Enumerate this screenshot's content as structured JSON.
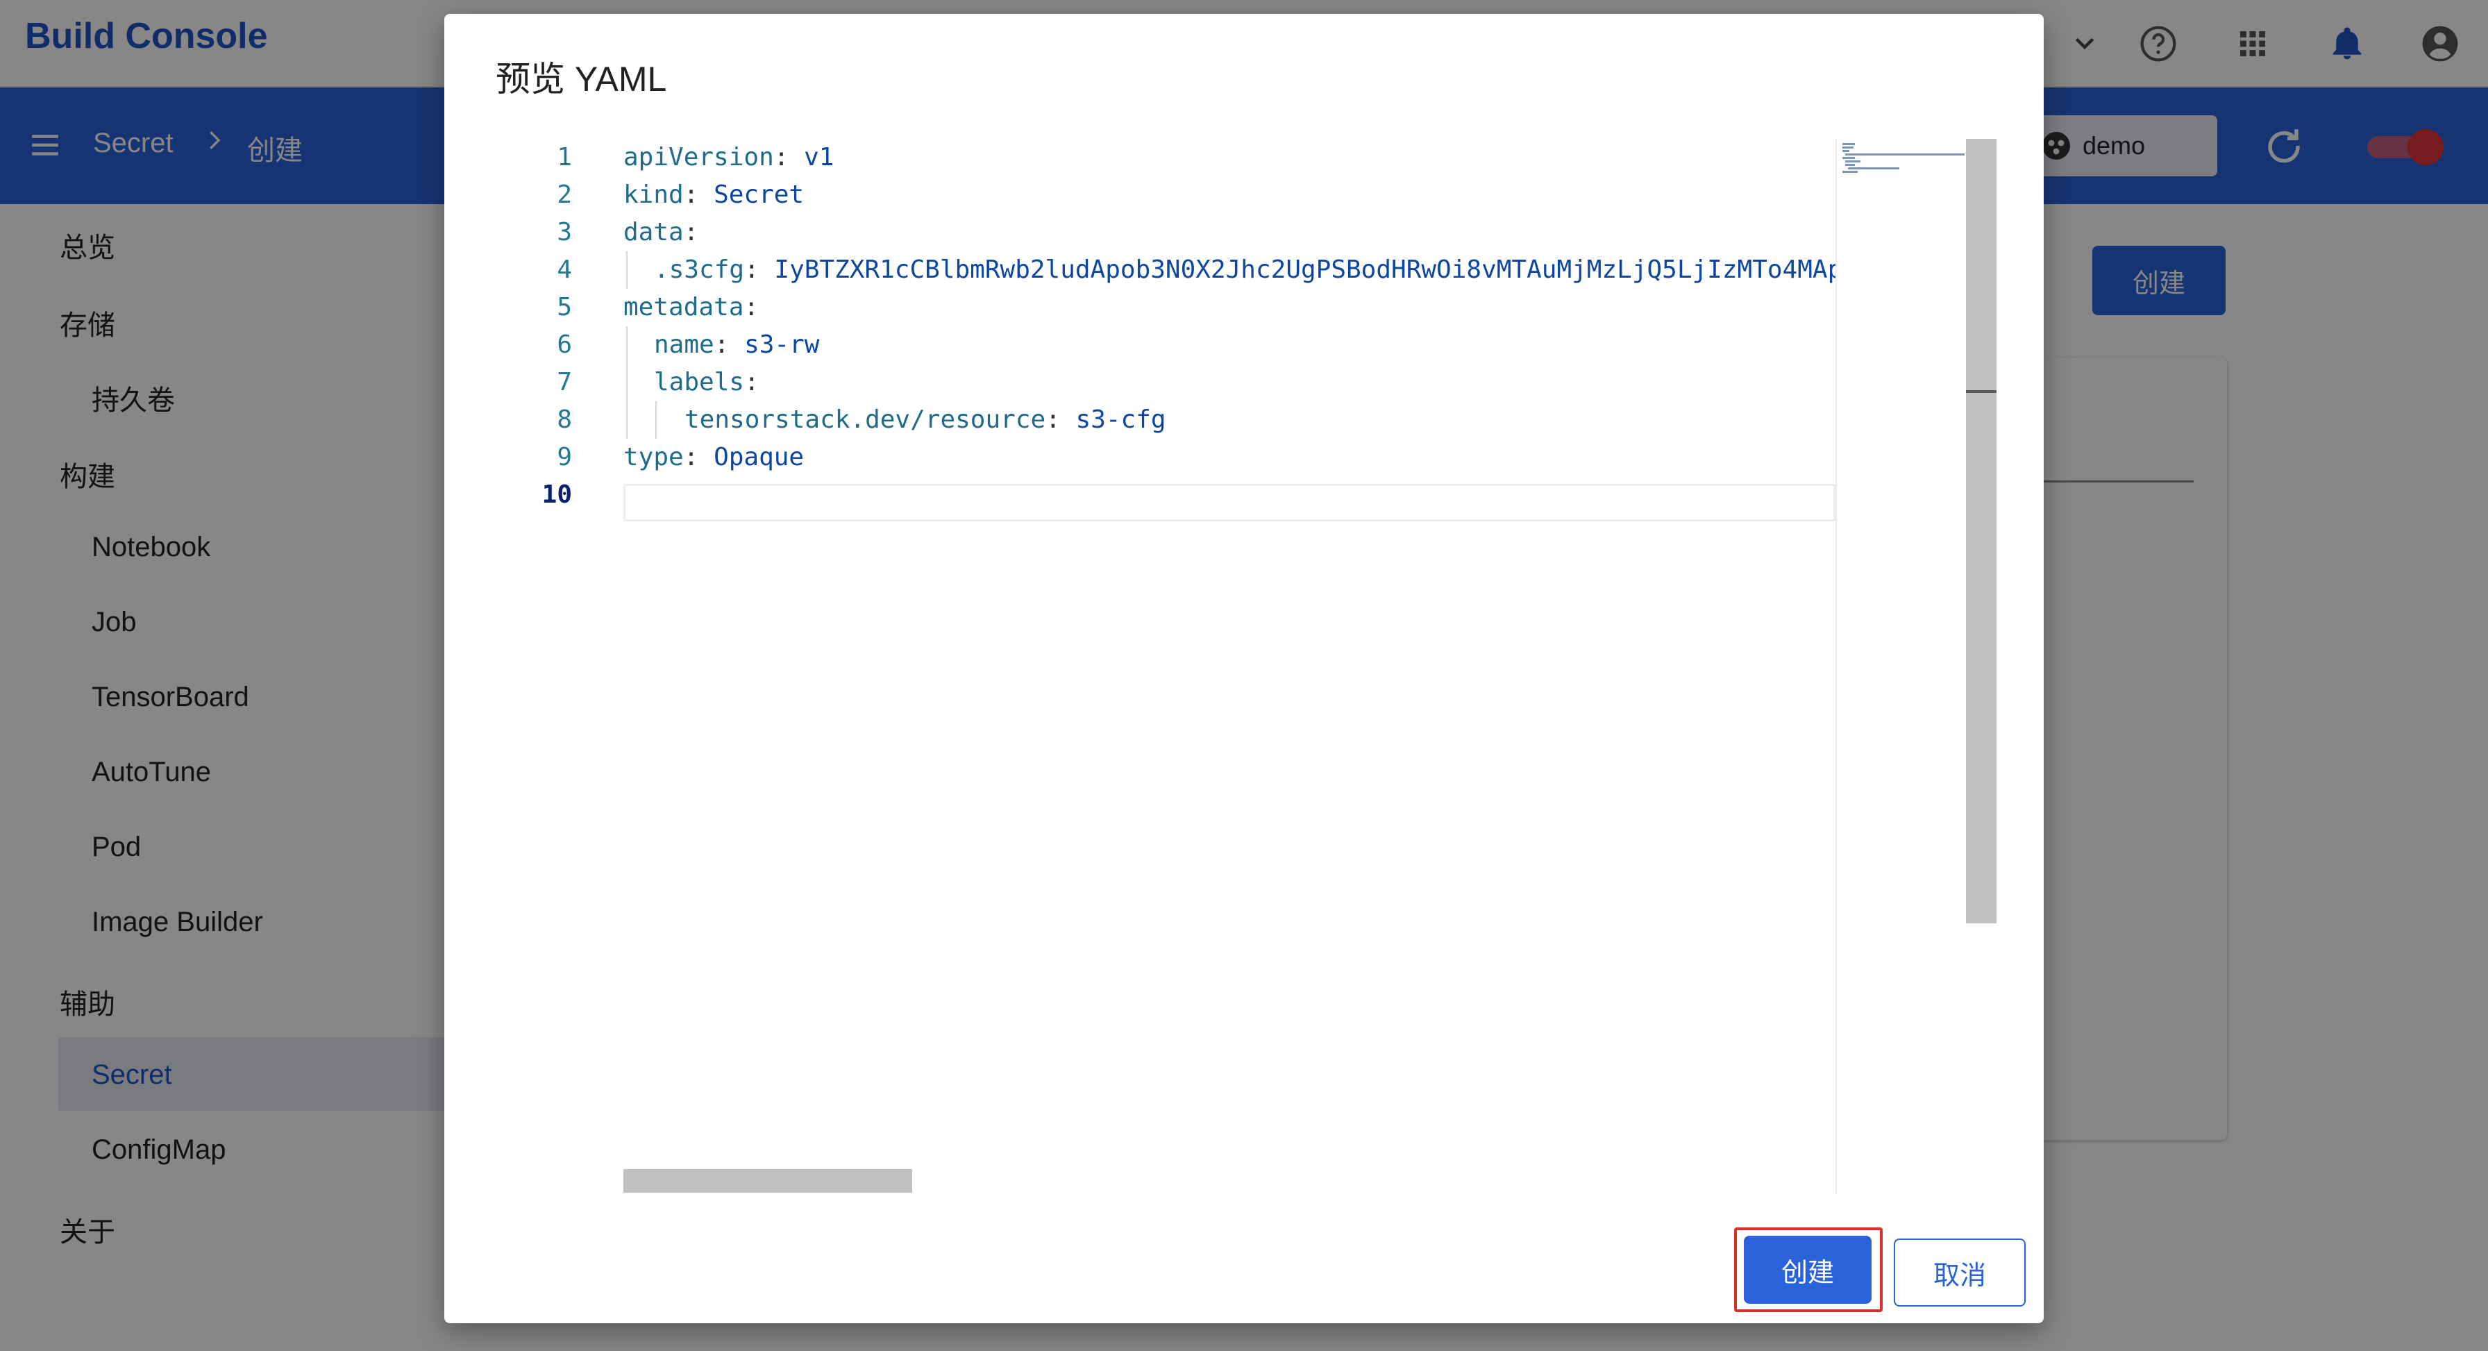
{
  "app": {
    "title": "Build Console"
  },
  "breadcrumb": {
    "items": [
      "Secret",
      "创建"
    ]
  },
  "namespace": {
    "value": "demo"
  },
  "sidebar": {
    "items": [
      {
        "label": "总览",
        "level": "top"
      },
      {
        "label": "存储",
        "level": "top"
      },
      {
        "label": "持久卷",
        "level": "sub"
      },
      {
        "label": "构建",
        "level": "top"
      },
      {
        "label": "Notebook",
        "level": "sub"
      },
      {
        "label": "Job",
        "level": "sub"
      },
      {
        "label": "TensorBoard",
        "level": "sub"
      },
      {
        "label": "AutoTune",
        "level": "sub"
      },
      {
        "label": "Pod",
        "level": "sub"
      },
      {
        "label": "Image Builder",
        "level": "sub"
      },
      {
        "label": "辅助",
        "level": "top"
      },
      {
        "label": "Secret",
        "level": "sub",
        "selected": true
      },
      {
        "label": "ConfigMap",
        "level": "sub"
      },
      {
        "label": "关于",
        "level": "top"
      }
    ]
  },
  "page": {
    "create_label": "创建"
  },
  "dialog": {
    "title": "预览 YAML",
    "line_numbers": [
      "1",
      "2",
      "3",
      "4",
      "5",
      "6",
      "7",
      "8",
      "9",
      "10"
    ],
    "code": {
      "l1": {
        "k": "apiVersion",
        "v": "v1"
      },
      "l2": {
        "k": "kind",
        "v": "Secret"
      },
      "l3": {
        "k": "data"
      },
      "l4": {
        "k": ".s3cfg",
        "v": "IyBTZXR1cCBlbmRwb2ludApob3N0X2Jhc2UgPSBodHRwOi8vMTAuMjMzLjQ5LjIzMTo4MAp"
      },
      "l5": {
        "k": "metadata"
      },
      "l6": {
        "k": "name",
        "v": "s3-rw"
      },
      "l7": {
        "k": "labels"
      },
      "l8": {
        "k": "tensorstack.dev/resource",
        "v": "s3-cfg"
      },
      "l9": {
        "k": "type",
        "v": "Opaque"
      }
    },
    "create_label": "创建",
    "cancel_label": "取消"
  },
  "colors": {
    "brand": "#1f55c9",
    "accent": "#2a62d9",
    "highlight": "#d9302c"
  },
  "icons": [
    "chevron-down-icon",
    "help-icon",
    "apps-grid-icon",
    "bell-icon",
    "account-icon",
    "menu-icon",
    "namespace-icon",
    "refresh-icon",
    "toggle-switch"
  ]
}
